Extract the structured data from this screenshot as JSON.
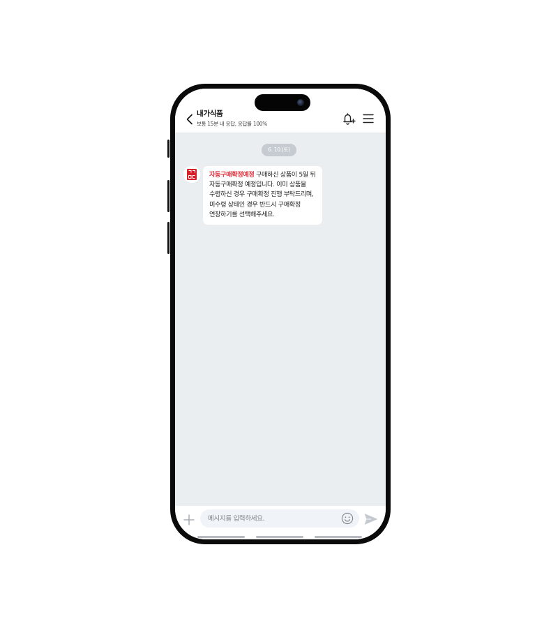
{
  "header": {
    "title": "내가식품",
    "subtitle": "보통 15분 내 응답, 응답률 100%"
  },
  "chat": {
    "date_label": "6. 10.(토)",
    "messages": [
      {
        "highlight": "자동구매확정예정",
        "text": " 구매하신 상품이 5일 뒤 자동구매확정 예정입니다. 이미 상품을 수령하신 경우 구매확정 진행 부탁드리며, 미수령 상태인 경우 반드시 구매확정 연장하기를 선택해주세요."
      }
    ]
  },
  "input": {
    "placeholder": "메시지를 입력하세요."
  },
  "icons": {
    "back": "chevron-left-icon",
    "bell": "bell-plus-icon",
    "menu": "hamburger-menu-icon",
    "plus": "plus-icon",
    "emoji": "smiley-icon",
    "send": "send-icon",
    "avatar_logo": "brand-logo-icon"
  },
  "colors": {
    "highlight": "#e2333f",
    "chat_background": "#ebeef1",
    "date_pill": "#c6cbd1",
    "logo_red": "#d8202b"
  }
}
